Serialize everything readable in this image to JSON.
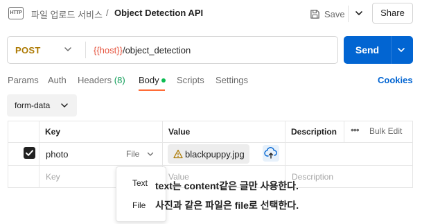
{
  "header": {
    "app_icon_text": "HTTP",
    "breadcrumb_parent": "파일 업로드 서비스",
    "breadcrumb_sep": "/",
    "title": "Object Detection API",
    "save_label": "Save",
    "share_label": "Share"
  },
  "request": {
    "method": "POST",
    "method_color": "#ad7a03",
    "url_var": "{{host}}",
    "url_path": "/object_detection",
    "send_label": "Send",
    "send_color": "#0265d2"
  },
  "tabs": [
    {
      "label": "Params"
    },
    {
      "label": "Auth"
    },
    {
      "label": "Headers",
      "count": "(8)"
    },
    {
      "label": "Body",
      "active": true
    },
    {
      "label": "Scripts"
    },
    {
      "label": "Settings"
    }
  ],
  "cookies_label": "Cookies",
  "body_mode": {
    "label": "form-data"
  },
  "table": {
    "headers": {
      "key": "Key",
      "value": "Value",
      "description": "Description",
      "bulk_edit": "Bulk Edit"
    },
    "row": {
      "key": "photo",
      "type": "File",
      "value": "blackpuppy.jpg",
      "checked": true
    },
    "placeholder": {
      "key": "Key",
      "value": "Value",
      "description": "Description"
    }
  },
  "dropdown": {
    "options": [
      "Text",
      "File"
    ]
  },
  "annotations": {
    "text": "text는 content같은 글만 사용한다.",
    "file": "사진과 같은 파일은 file로 선택한다."
  }
}
